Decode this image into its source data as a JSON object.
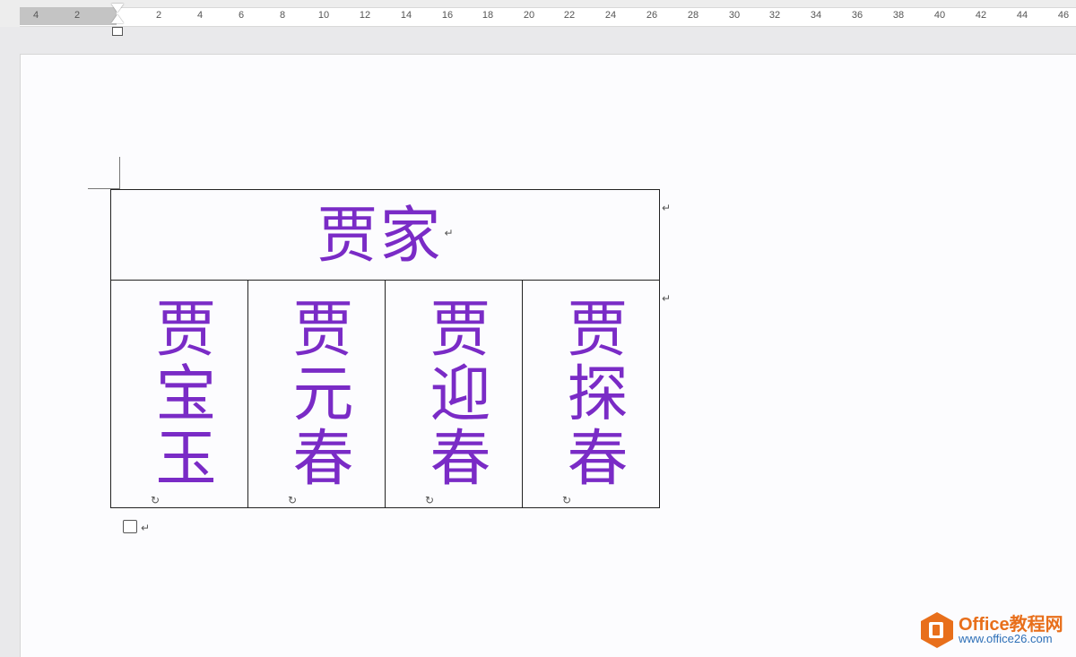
{
  "ruler": {
    "ticks": [
      "4",
      "2",
      "2",
      "4",
      "6",
      "8",
      "10",
      "12",
      "14",
      "16",
      "18",
      "20",
      "22",
      "24",
      "26",
      "28",
      "30",
      "32",
      "34",
      "36",
      "38",
      "40",
      "42",
      "44",
      "46"
    ]
  },
  "document": {
    "table": {
      "header": "贾家",
      "names": [
        "贾宝玉",
        "贾元春",
        "贾迎春",
        "贾探春"
      ]
    },
    "paragraph_mark": "↵",
    "cell_mark": "↻"
  },
  "watermark": {
    "brand": "Office教程网",
    "url": "www.office26.com"
  },
  "colors": {
    "text_accent": "#7a2bc6",
    "brand_orange": "#e86f1b",
    "brand_blue": "#2d6fb7"
  }
}
